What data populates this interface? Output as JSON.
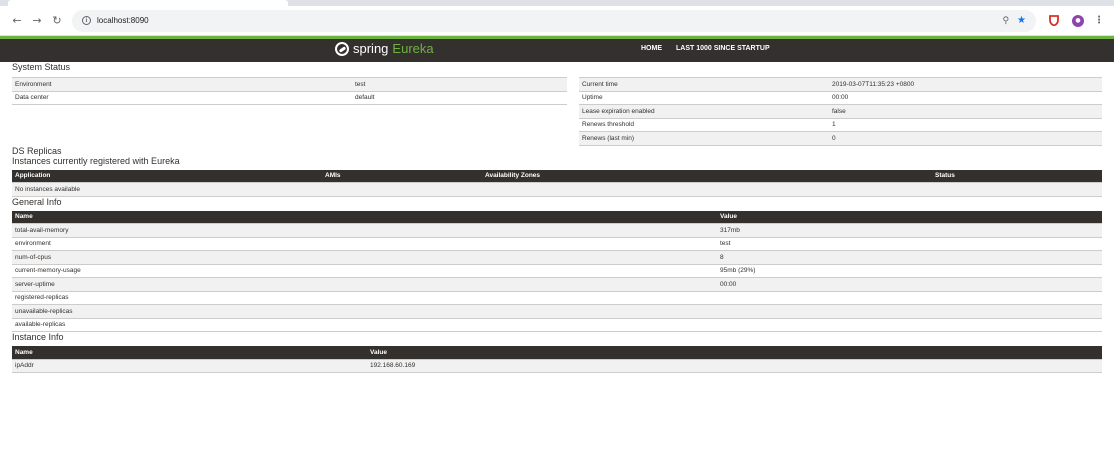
{
  "browser": {
    "url": "localhost:8090",
    "back_icon": "arrow-left-icon",
    "forward_icon": "arrow-right-icon",
    "reload_icon": "reload-icon"
  },
  "nav": {
    "brand_spring": "spring",
    "brand_eureka": "Eureka",
    "home": "HOME",
    "last1000": "LAST 1000 SINCE STARTUP",
    "accent": "#6db33f",
    "bar_color": "#34302d"
  },
  "system_status": {
    "title": "System Status",
    "left": [
      {
        "key": "Environment",
        "value": "test"
      },
      {
        "key": "Data center",
        "value": "default"
      }
    ],
    "right": [
      {
        "key": "Current time",
        "value": "2019-03-07T11:35:23 +0800"
      },
      {
        "key": "Uptime",
        "value": "00:00"
      },
      {
        "key": "Lease expiration enabled",
        "value": "false"
      },
      {
        "key": "Renews threshold",
        "value": "1"
      },
      {
        "key": "Renews (last min)",
        "value": "0"
      }
    ]
  },
  "ds_replicas": {
    "title": "DS Replicas"
  },
  "instances": {
    "title": "Instances currently registered with Eureka",
    "headers": {
      "application": "Application",
      "amis": "AMIs",
      "zones": "Availability Zones",
      "status": "Status"
    },
    "empty": "No instances available"
  },
  "general_info": {
    "title": "General Info",
    "headers": {
      "name": "Name",
      "value": "Value"
    },
    "rows": [
      {
        "name": "total-avail-memory",
        "value": "317mb"
      },
      {
        "name": "environment",
        "value": "test"
      },
      {
        "name": "num-of-cpus",
        "value": "8"
      },
      {
        "name": "current-memory-usage",
        "value": "95mb (29%)"
      },
      {
        "name": "server-uptime",
        "value": "00:00"
      },
      {
        "name": "registered-replicas",
        "value": ""
      },
      {
        "name": "unavailable-replicas",
        "value": ""
      },
      {
        "name": "available-replicas",
        "value": ""
      }
    ]
  },
  "instance_info": {
    "title": "Instance Info",
    "headers": {
      "name": "Name",
      "value": "Value"
    },
    "rows": [
      {
        "name": "ipAddr",
        "value": "192.168.60.169"
      }
    ]
  }
}
